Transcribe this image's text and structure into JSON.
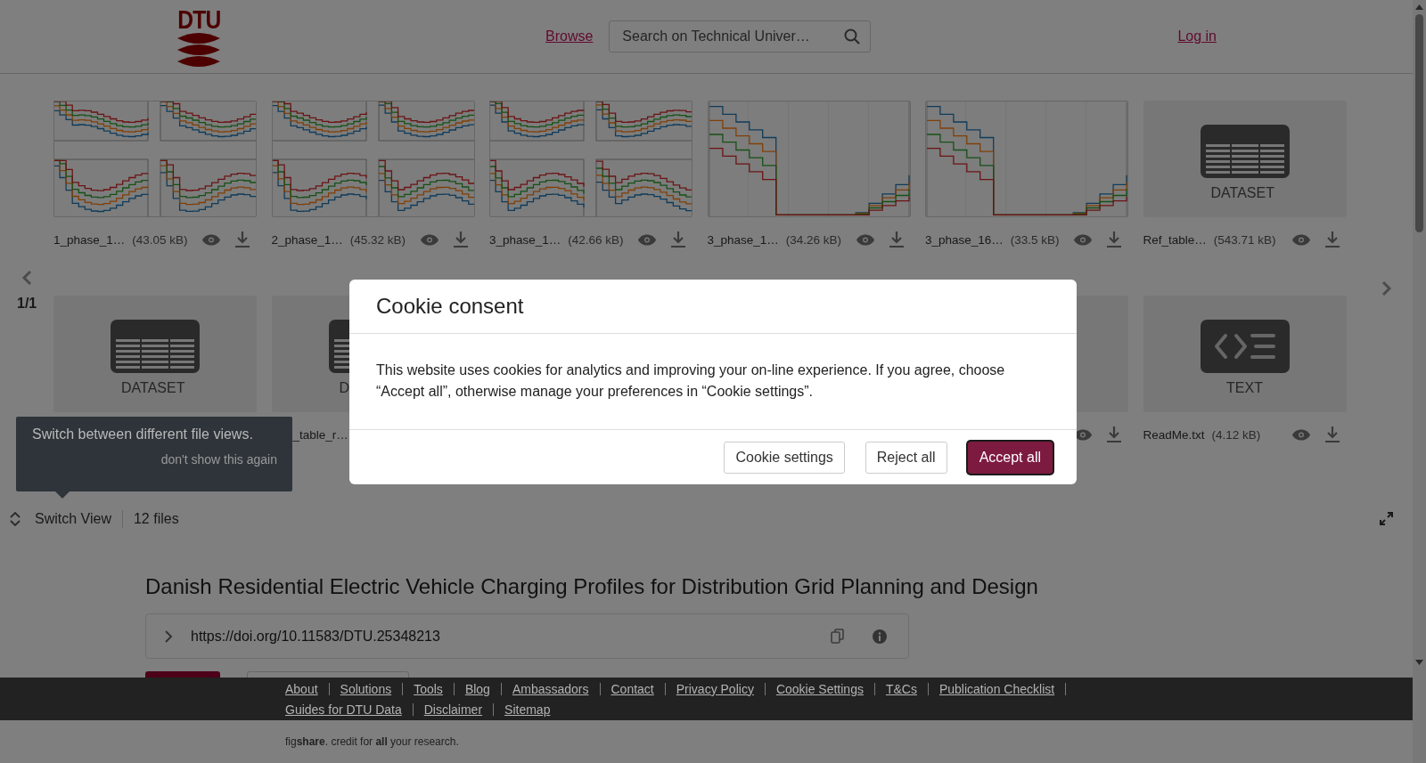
{
  "header": {
    "logo": "DTU",
    "nav": "Browse",
    "search": {
      "placeholder": "Search on Technical Univer…"
    },
    "login": "Log in"
  },
  "carousel": {
    "pager": "1/1",
    "rows": [
      [
        {
          "kind": "picture",
          "name": "1_phase_1…",
          "size": "(43.05 kB)",
          "view": true,
          "download": true
        },
        {
          "kind": "picture",
          "name": "2_phase_1…",
          "size": "(45.32 kB)",
          "view": true,
          "download": true
        },
        {
          "kind": "picture",
          "name": "3_phase_1…",
          "size": "(42.66 kB)",
          "view": true,
          "download": true
        },
        {
          "kind": "picture",
          "name": "3_phase_1…",
          "size": "(34.26 kB)",
          "view": true,
          "download": true
        },
        {
          "kind": "picture",
          "name": "3_phase_16…",
          "size": "(33.5 kB)",
          "view": true,
          "download": true
        },
        {
          "kind": "dataset",
          "label": "DATASET",
          "name": "Ref_table…",
          "size": "(543.71 kB)",
          "view": true,
          "download": true
        }
      ],
      [
        {
          "kind": "dataset",
          "label": "DATASET"
        },
        {
          "kind": "dataset",
          "label": "D",
          "name": "_table_r…"
        },
        "",
        "",
        {
          "kind": "tile",
          "view": true,
          "download": true
        },
        {
          "kind": "text",
          "label": "TEXT",
          "name": "ReadMe.txt",
          "size": "(4.12 kB)",
          "view": true,
          "download": true
        }
      ]
    ]
  },
  "switch_bar": {
    "label": "Switch View",
    "count": "12 files"
  },
  "tooltip": {
    "text": "Switch between different file views.",
    "dismiss": "don't show this again"
  },
  "item": {
    "title": "Danish Residential Electric Vehicle Charging Profiles for Distribution Grid Planning and Design",
    "doi": "https://doi.org/10.11583/DTU.25348213"
  },
  "footer": {
    "links": [
      "About",
      "Solutions",
      "Tools",
      "Blog",
      "Ambassadors",
      "Contact",
      "Privacy Policy",
      "Cookie Settings",
      "T&Cs",
      "Publication Checklist",
      "Guides for DTU Data",
      "Disclaimer",
      "Sitemap"
    ],
    "tagline": "fig**share**. credit for **all** your research."
  },
  "cookie_dialog": {
    "title": "Cookie consent",
    "text": "This website uses cookies for analytics and improving your on-line experience. If you agree, choose “Accept all”, otherwise manage your preferences in “Cookie settings”.",
    "buttons": [
      {
        "label": "Cookie settings",
        "kind": "secondary"
      },
      {
        "label": "Reject all",
        "kind": "secondary"
      },
      {
        "label": "Accept all",
        "kind": "primary"
      }
    ]
  }
}
